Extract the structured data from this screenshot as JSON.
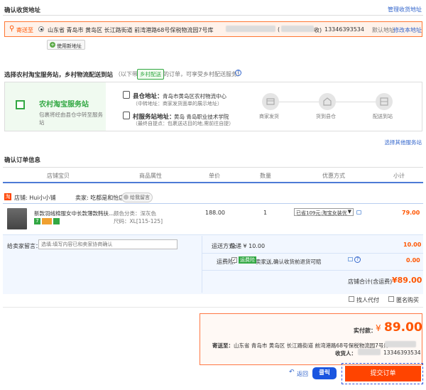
{
  "address": {
    "section_title": "确认收货地址",
    "manage_link": "管理收货地址",
    "ship_to_label": "寄送至",
    "address_text": "山东省 青岛市 黄岛区 长江路街道 前湾港路68号保税物流园7号库",
    "recipient_suffix": "收)",
    "phone": "13346393534",
    "default_label": "默认地址",
    "edit_link": "修改本地址",
    "use_new_button": "使用新地址"
  },
  "rural": {
    "section_title": "选择农村淘宝服务站，乡村物流配送到站",
    "section_note_pre": "（以下带",
    "tag": "乡村配送",
    "section_note_post": "的订单，可享受乡村配送服务）",
    "station_name": "农村淘宝服务站",
    "station_desc": "包裹将经由县仓中转至服务站",
    "county_label": "县仓地址：",
    "county_value": "青岛市黄岛区农村物流中心",
    "county_note": "（中转地址：商家发货面单的展示地址）",
    "village_label": "村服务站地址：",
    "village_value": "黄岛 青岛职业技术学院",
    "village_note": "（最终自提点：包裹送达目的地,需前往自提）",
    "steps": [
      "商家发货",
      "货到县仓",
      "配送到站"
    ],
    "other_link": "选择其他服务站"
  },
  "order": {
    "section_title": "确认订单信息",
    "columns": [
      "店铺宝贝",
      "商品属性",
      "单价",
      "数量",
      "优惠方式",
      "小计"
    ],
    "shop_label": "店铺: Hui小小铺",
    "seller_label": "卖家: 吃都是和怡店",
    "contact_label": "给我留言",
    "item_title": "新款羽绒棉服女中长款薄款韩扶...",
    "color_attr": "颜色分类：深灰色",
    "size_attr": "尺码：XL[115-125]",
    "price": "188.00",
    "quantity": "1",
    "discount": "已省109元:淘宝女装优",
    "subtotal": "79.00",
    "message_label": "给卖家留言：",
    "message_placeholder": "选填:填写内容已和卖家协商确认",
    "shipping_label": "运送方式:",
    "shipping_value": "快递 ¥ 10.00",
    "shipping_cost": "10.00",
    "insurance_label": "运费险:",
    "insurance_tag": "运费险",
    "insurance_text": "卖家送,确认收货前退货可赔",
    "insurance_cost": "0.00",
    "shop_total_label": "店铺合计(含运费)",
    "shop_total_value": "¥89.00",
    "proxy_pay": "找人代付",
    "anonymous": "匿名购买"
  },
  "summary": {
    "paid_label": "实付款：",
    "currency": "¥",
    "paid_amount": "89.00",
    "ship_to_label": "寄送至：",
    "ship_to_value": "山东省 青岛市 黄岛区 长江路街道 前湾港路68号保税物流园7号库",
    "recipient_label": "收货人：",
    "recipient_phone": "13346393534",
    "back_link": "返回",
    "click_badge": "클릭",
    "submit_button": "提交订单"
  },
  "colors": {
    "accent": "#ff5500",
    "submit_bg": "#ff4400",
    "green": "#32a843",
    "badge_blue": "#1a55e0"
  }
}
